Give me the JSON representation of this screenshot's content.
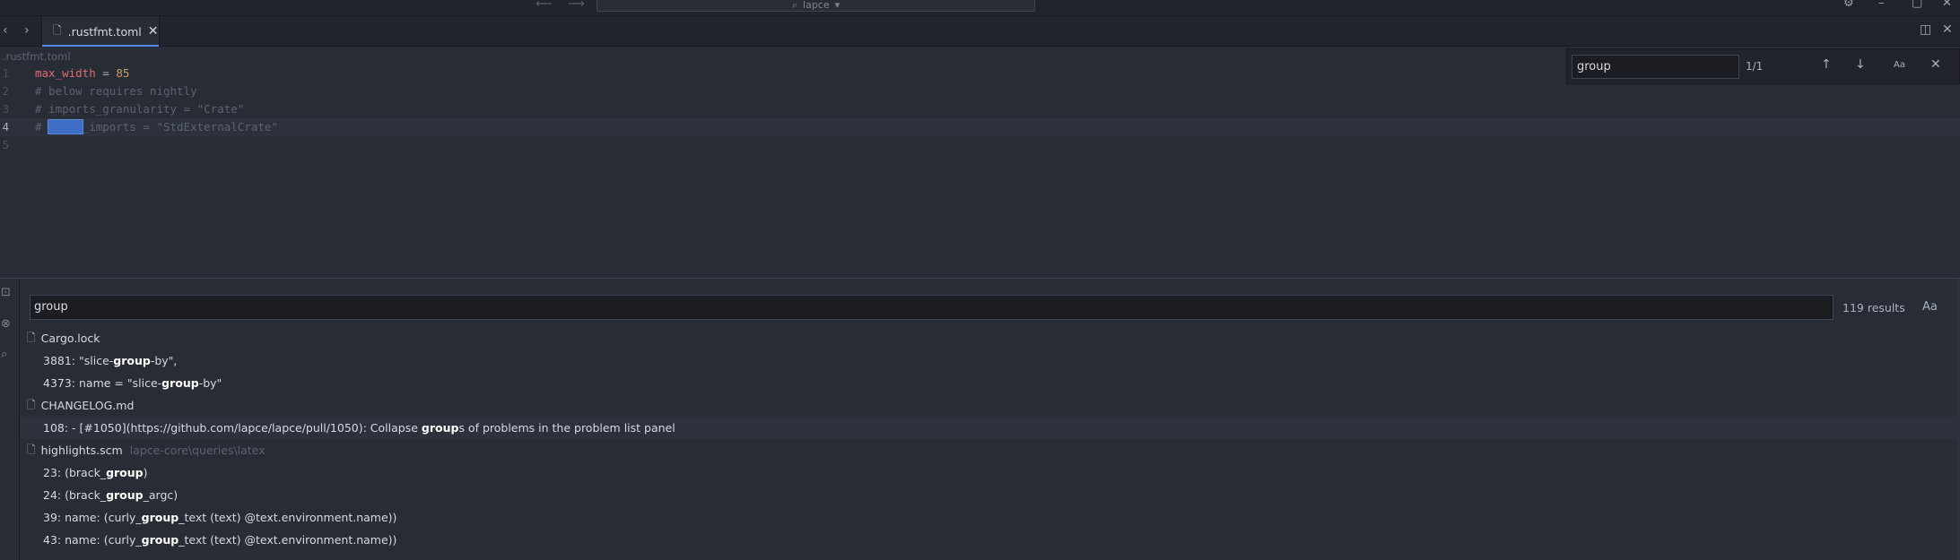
{
  "titlebar": {
    "back_icon": "arrow-left-icon",
    "forward_icon": "arrow-right-icon",
    "workspace": "lapce",
    "settings_icon": "gear-icon",
    "minimize_icon": "minimize-icon",
    "maximize_icon": "maximize-icon",
    "close_icon": "close-icon"
  },
  "tabs": [
    {
      "label": ".rustfmt.toml",
      "active": true
    }
  ],
  "breadcrumb": ".rustfmt.toml",
  "editor": {
    "lines": [
      {
        "num": "1"
      },
      {
        "num": "2",
        "text": "# below requires nightly"
      },
      {
        "num": "3",
        "text": "# imports_granularity = \"Crate\""
      },
      {
        "num": "4"
      },
      {
        "num": "5"
      }
    ],
    "line1": {
      "key": "max_width",
      "op": " = ",
      "value": "85"
    },
    "line4": {
      "prefix": "# ",
      "match": "group",
      "rest": "_imports = \"StdExternalCrate\""
    }
  },
  "find": {
    "query": "group",
    "count": "1/1",
    "case_label": "Aa"
  },
  "search_panel": {
    "query": "group",
    "results_count": "119 results",
    "case_label": "Aa",
    "files": [
      {
        "name": "Cargo.lock",
        "path": "",
        "matches": [
          {
            "pre": "3881: \"slice-",
            "hit": "group",
            "post": "-by\","
          },
          {
            "pre": "4373: name = \"slice-",
            "hit": "group",
            "post": "-by\""
          }
        ]
      },
      {
        "name": "CHANGELOG.md",
        "path": "",
        "matches": [
          {
            "pre": "108: - [#1050](https://github.com/lapce/lapce/pull/1050): Collapse ",
            "hit": "group",
            "post": "s of problems in the problem list panel"
          }
        ]
      },
      {
        "name": "highlights.scm",
        "path": "lapce-core\\queries\\latex",
        "matches": [
          {
            "pre": "23: (brack_",
            "hit": "group",
            "post": ")"
          },
          {
            "pre": "24: (brack_",
            "hit": "group",
            "post": "_argc)"
          },
          {
            "pre": "39: name: (curly_",
            "hit": "group",
            "post": "_text (text) @text.environment.name))"
          },
          {
            "pre": "43: name: (curly_",
            "hit": "group",
            "post": "_text (text) @text.environment.name))"
          }
        ]
      }
    ]
  }
}
